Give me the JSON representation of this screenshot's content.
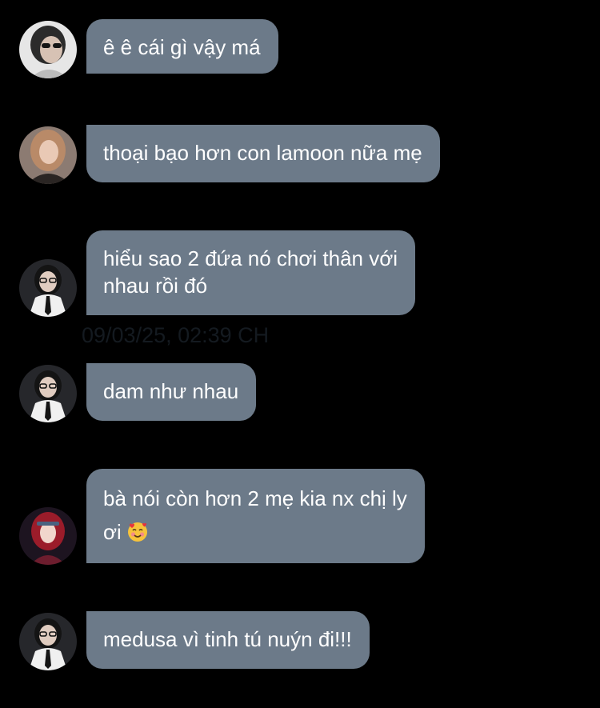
{
  "colors": {
    "background": "#000000",
    "bubble": "#6c7a89",
    "bubble_text": "#ffffff",
    "timestamp": "#141a20"
  },
  "messages": [
    {
      "avatar": "avatar-woman-sunglasses",
      "text": "ê ê cái gì vậy má"
    },
    {
      "avatar": "avatar-woman-blonde",
      "text": "thoại bạo hơn con lamoon nữa mẹ"
    },
    {
      "avatar": "avatar-woman-glasses-tie",
      "line1": "hiểu sao 2 đứa nó chơi thân với",
      "line2": "nhau rồi đó"
    },
    {
      "avatar": "avatar-woman-glasses-tie",
      "text": "dam như nhau"
    },
    {
      "avatar": "avatar-anime-redhair",
      "line1": "bà nói còn hơn 2 mẹ kia nx chị ly",
      "line2": "ơi",
      "emoji": "smiling-face-with-hearts"
    },
    {
      "avatar": "avatar-woman-glasses-tie",
      "text": "medusa vì tinh tú nuýn đi!!!"
    }
  ],
  "timestamps": {
    "t3": "09/03/25, 02:39 CH"
  }
}
